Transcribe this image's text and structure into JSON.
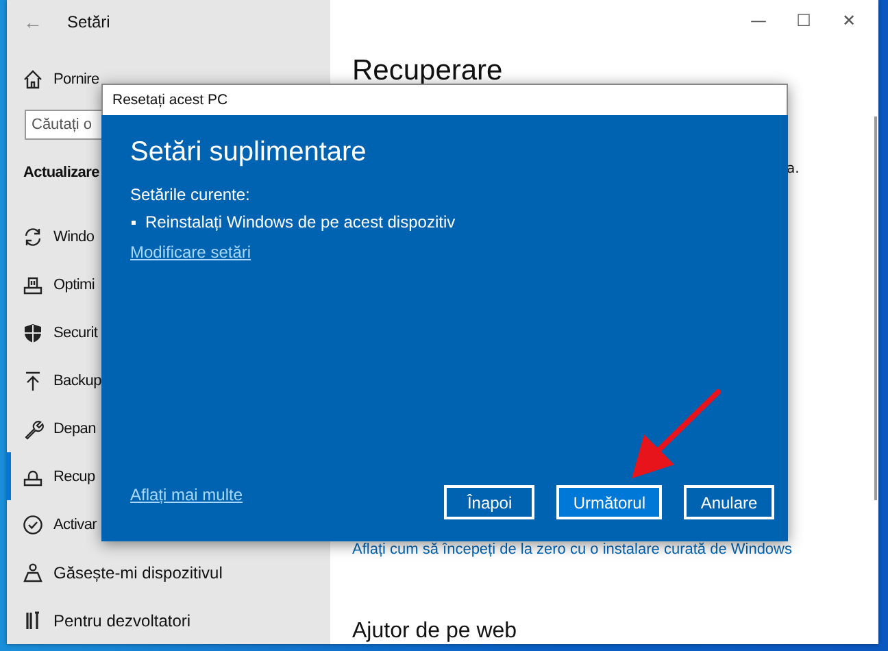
{
  "window": {
    "title": "Setări",
    "back": "←",
    "controls": [
      "—",
      "☐",
      "✕"
    ]
  },
  "sidebar": {
    "home": "Pornire",
    "search": {
      "placeholder": "Căutați o"
    },
    "section": "Actualizare",
    "items": [
      {
        "label": "Windo",
        "selected": false
      },
      {
        "label": "Optimi",
        "selected": false
      },
      {
        "label": "Securit",
        "selected": false
      },
      {
        "label": "Backup",
        "selected": false
      },
      {
        "label": "Depan",
        "selected": false
      },
      {
        "label": "Recup",
        "selected": true
      },
      {
        "label": "Activar",
        "selected": false
      },
      {
        "label": "Găsește-mi dispozitivul",
        "selected": false
      },
      {
        "label": "Pentru dezvoltatori",
        "selected": false
      }
    ]
  },
  "content": {
    "title": "Recuperare",
    "fragment": "a.",
    "link": "Aflați cum să începeți de la zero cu o instalare curată de Windows",
    "help_title": "Ajutor de pe web"
  },
  "dialog": {
    "title": "Resetați acest PC",
    "heading": "Setări suplimentare",
    "label": "Setările curente:",
    "bullets": [
      "Reinstalați Windows de pe acest dispozitiv"
    ],
    "change_link": "Modificare setări",
    "learn_link": "Aflați mai multe",
    "buttons": [
      {
        "label": "Înapoi",
        "default": false
      },
      {
        "label": "Următorul",
        "default": true
      },
      {
        "label": "Anulare",
        "default": false
      }
    ]
  }
}
